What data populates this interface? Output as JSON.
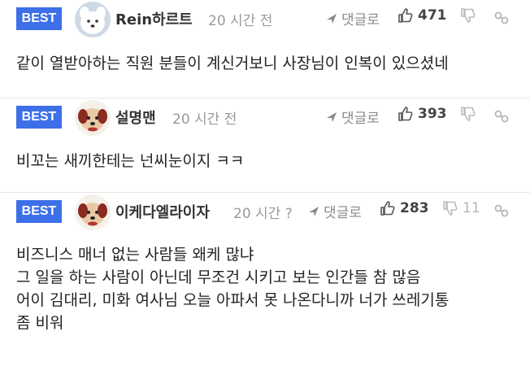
{
  "comments": [
    {
      "badge": "BEST",
      "avatar": "white-dog-avatar",
      "nickname": "Rein하르트",
      "time": "20 시간 전",
      "reply_label": "댓글로",
      "likes": "471",
      "dislikes": "",
      "lines": [
        "같이 열받아하는 직원 분들이 계신거보니 사장님이 인복이 있으셨네"
      ]
    },
    {
      "badge": "BEST",
      "avatar": "puppy-face-avatar",
      "nickname": "설명맨",
      "time": "20 시간 전",
      "reply_label": "댓글로",
      "likes": "393",
      "dislikes": "",
      "lines": [
        "비꼬는 새끼한테는 넌씨눈이지 ㅋㅋ"
      ]
    },
    {
      "badge": "BEST",
      "avatar": "puppy-face-avatar",
      "nickname": "이케다엘라이자",
      "time": "20 시간 ?",
      "reply_label": "댓글로",
      "likes": "283",
      "dislikes": "11",
      "lines": [
        "비즈니스 매너 없는 사람들 왜케 많냐",
        "그 일을 하는 사람이 아닌데 무조건 시키고 보는 인간들 참 많음",
        "어이 김대리, 미화 여사님 오늘 아파서 못 나온다니까 너가 쓰레기통",
        "좀 비워"
      ]
    }
  ],
  "colors": {
    "badge": "#3d6fe8",
    "muted": "#9a9a9a",
    "divider": "#e6e6e6"
  },
  "icons": {
    "reply": "paper-plane-icon",
    "like": "thumbs-up-icon",
    "dislike": "thumbs-down-icon",
    "share": "link-icon"
  }
}
